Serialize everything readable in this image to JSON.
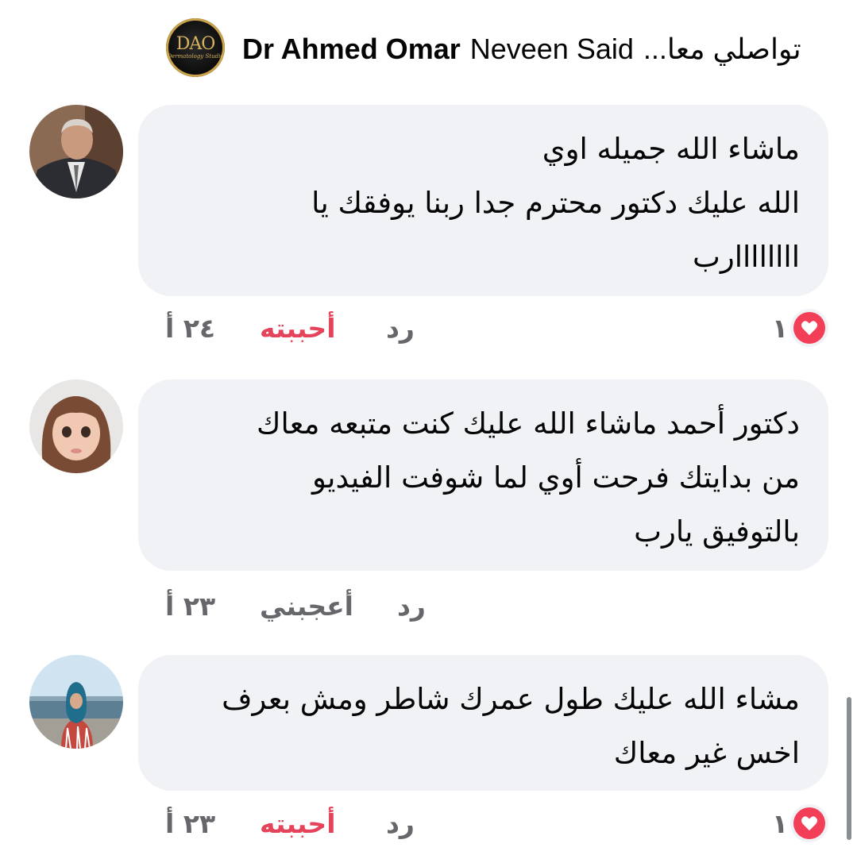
{
  "header": {
    "page_name": "Dr Ahmed Omar",
    "commenter_name": "Neveen Said",
    "snippet": "تواصلي معا...",
    "logo_text": "DAO",
    "logo_sub": "Dermatology Studio"
  },
  "comments": [
    {
      "lines": [
        "ماشاء الله جميله اوي",
        "الله عليك دكتور محترم جدا ربنا يوفقك يا",
        "اااااااارب"
      ],
      "time": "٢٤ أ",
      "like_label": "أحببته",
      "like_state": "loved",
      "reply_label": "رد",
      "reaction_count": "١",
      "reaction_icon": "heart-icon",
      "avatar": "elderly-man-photo"
    },
    {
      "lines": [
        "دكتور أحمد ماشاء الله عليك كنت متبعه معاك",
        "من بدايتك فرحت أوي لما شوفت الفيديو",
        "بالتوفيق يارب"
      ],
      "time": "٢٣ أ",
      "like_label": "أعجبني",
      "like_state": "none",
      "reply_label": "رد",
      "reaction_count": "",
      "avatar": "little-girl-photo"
    },
    {
      "lines": [
        "مشاء الله عليك طول عمرك شاطر ومش بعرف",
        "اخس غير معاك"
      ],
      "time": "٢٣ أ",
      "like_label": "أحببته",
      "like_state": "loved",
      "reply_label": "رد",
      "reaction_count": "١",
      "reaction_icon": "heart-icon",
      "avatar": "woman-hijab-photo"
    }
  ],
  "colors": {
    "bubble": "#f0f2f5",
    "love": "#e5435a",
    "muted": "#65676b",
    "text": "#050505"
  }
}
